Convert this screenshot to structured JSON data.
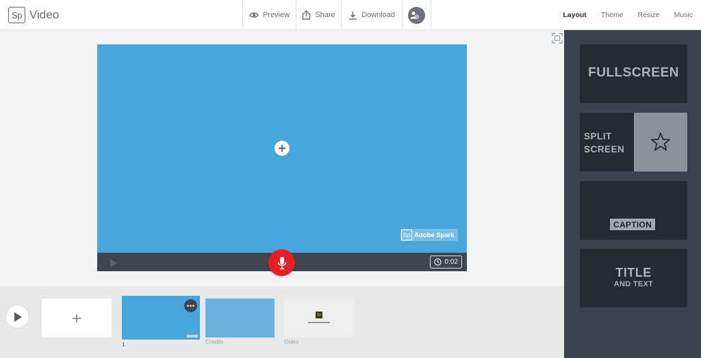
{
  "app": {
    "logo_mark": "Sp",
    "title": "Video"
  },
  "header": {
    "actions": [
      {
        "label": "Preview",
        "icon": "eye-icon"
      },
      {
        "label": "Share",
        "icon": "share-icon"
      },
      {
        "label": "Download",
        "icon": "download-icon"
      }
    ],
    "collaborator_icon": "add-collaborator-icon",
    "tabs": [
      {
        "label": "Layout",
        "active": true
      },
      {
        "label": "Theme",
        "active": false
      },
      {
        "label": "Resize",
        "active": false
      },
      {
        "label": "Music",
        "active": false
      }
    ]
  },
  "stage": {
    "watermark_mark": "Sp",
    "watermark_text": "Adobe Spark",
    "timer": "0:02",
    "canvas_color": "#47a6db",
    "record_color": "#e41e26"
  },
  "timeline": {
    "slides": [
      {
        "label": "1",
        "color": "#47a6db",
        "selected": true
      },
      {
        "label": "Credits",
        "color": "#6ab3df",
        "selected": false
      },
      {
        "label": "Outro",
        "color": "#eeeeee",
        "selected": false
      }
    ],
    "outro_mark": "Sp"
  },
  "layouts": {
    "fullscreen": "FULLSCREEN",
    "split_line1": "SPLIT",
    "split_line2": "SCREEN",
    "caption": "CAPTION",
    "title_line1": "TITLE",
    "title_line2": "AND TEXT"
  }
}
